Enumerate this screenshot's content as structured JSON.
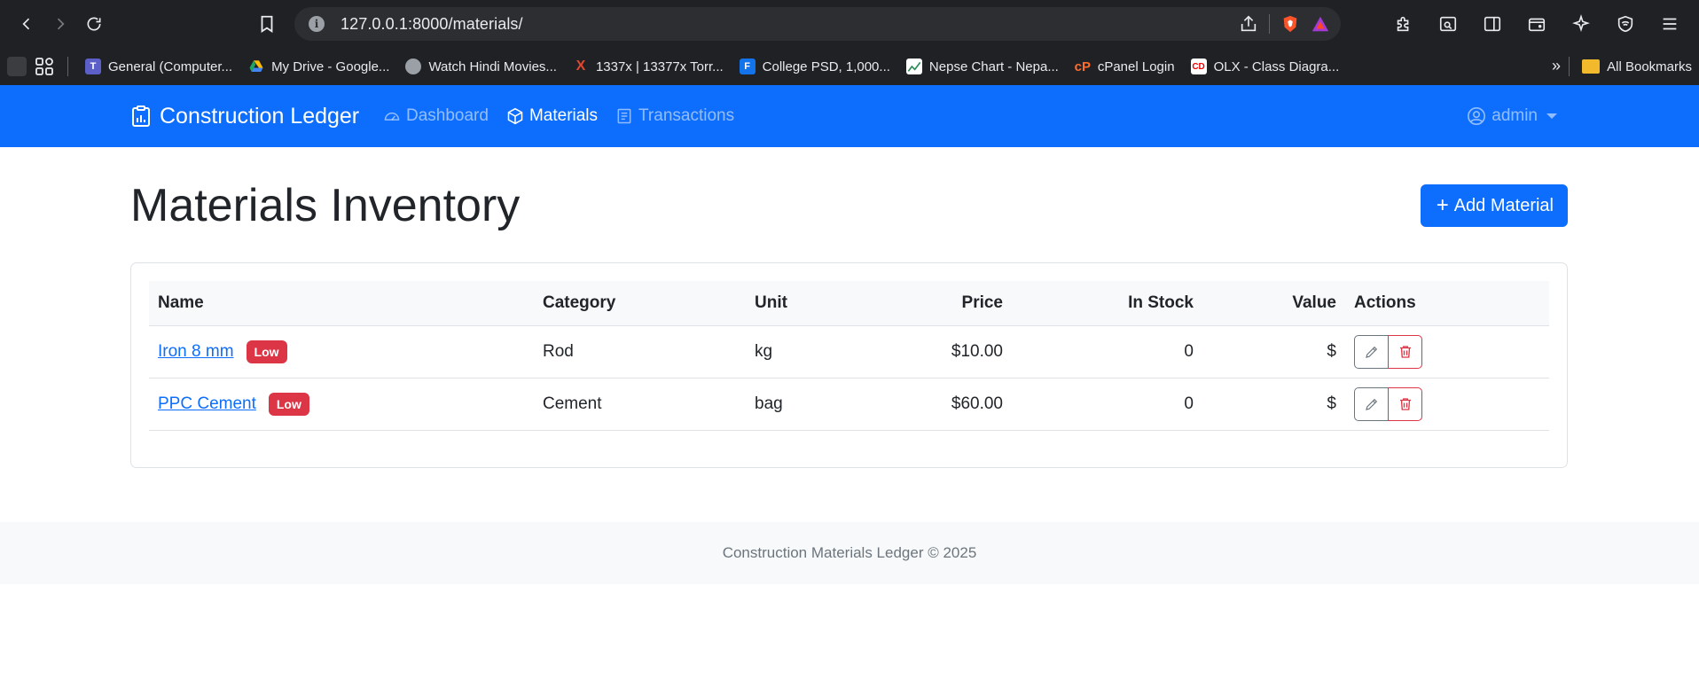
{
  "browser": {
    "url": "127.0.0.1:8000/materials/",
    "bookmarks": [
      {
        "label": "General (Computer...",
        "icon": "teams-icon",
        "color": "#5b5fc7"
      },
      {
        "label": "My Drive - Google...",
        "icon": "google-drive-icon",
        "color": "#1fa463"
      },
      {
        "label": "Watch Hindi Movies...",
        "icon": "globe-icon",
        "color": "#9aa0a6"
      },
      {
        "label": "1337x | 13377x Torr...",
        "icon": "1337x-icon",
        "color": "#e0482f"
      },
      {
        "label": "College PSD, 1,000...",
        "icon": "freepik-icon",
        "color": "#1273eb"
      },
      {
        "label": "Nepse Chart - Nepa...",
        "icon": "chart-icon",
        "color": "#2e8b57"
      },
      {
        "label": "cPanel Login",
        "icon": "cpanel-icon",
        "color": "#ff6c2c"
      },
      {
        "label": "OLX - Class Diagra...",
        "icon": "olx-icon",
        "color": "#ffffff"
      }
    ],
    "all_bookmarks": "All Bookmarks"
  },
  "navbar": {
    "brand": "Construction Ledger",
    "links": {
      "dashboard": "Dashboard",
      "materials": "Materials",
      "transactions": "Transactions"
    },
    "user": "admin"
  },
  "page": {
    "title": "Materials Inventory",
    "add_button": "Add Material"
  },
  "table": {
    "headers": {
      "name": "Name",
      "category": "Category",
      "unit": "Unit",
      "price": "Price",
      "in_stock": "In Stock",
      "value": "Value",
      "actions": "Actions"
    },
    "rows": [
      {
        "name": "Iron 8 mm",
        "badge": "Low",
        "category": "Rod",
        "unit": "kg",
        "price": "$10.00",
        "in_stock": "0",
        "value": "$"
      },
      {
        "name": "PPC Cement",
        "badge": "Low",
        "category": "Cement",
        "unit": "bag",
        "price": "$60.00",
        "in_stock": "0",
        "value": "$"
      }
    ]
  },
  "footer": {
    "text": "Construction Materials Ledger © 2025"
  },
  "colors": {
    "primary": "#0d6efd",
    "danger": "#dc3545",
    "chrome_bg": "#202124"
  }
}
